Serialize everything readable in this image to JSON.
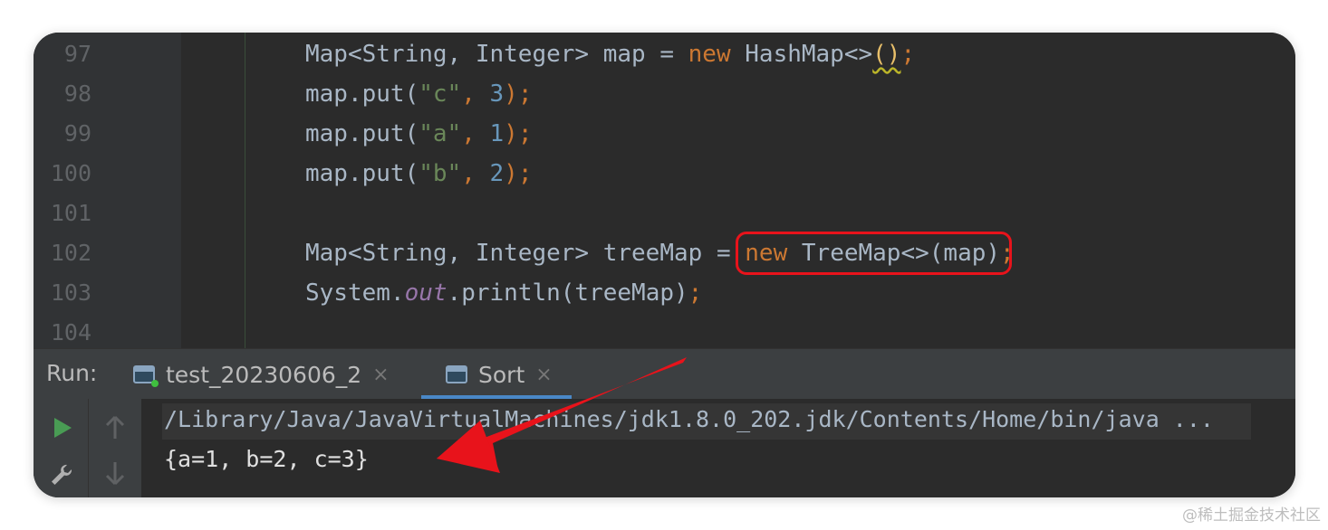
{
  "editor": {
    "line_numbers": [
      "97",
      "98",
      "99",
      "100",
      "101",
      "102",
      "103",
      "104"
    ],
    "lines": [
      [
        {
          "t": "Map<String, Integer> map = ",
          "c": "plain"
        },
        {
          "t": "new",
          "c": "kw"
        },
        {
          "t": " HashMap<>",
          "c": "plain"
        },
        {
          "t": "()",
          "c": "brace squig"
        },
        {
          "t": ";",
          "c": "kw"
        }
      ],
      [
        {
          "t": "map.put(",
          "c": "plain"
        },
        {
          "t": "\"c\"",
          "c": "str"
        },
        {
          "t": ", ",
          "c": "kw"
        },
        {
          "t": "3",
          "c": "num"
        },
        {
          "t": ");",
          "c": "kw"
        }
      ],
      [
        {
          "t": "map.put(",
          "c": "plain"
        },
        {
          "t": "\"a\"",
          "c": "str"
        },
        {
          "t": ", ",
          "c": "kw"
        },
        {
          "t": "1",
          "c": "num"
        },
        {
          "t": ");",
          "c": "kw"
        }
      ],
      [
        {
          "t": "map.put(",
          "c": "plain"
        },
        {
          "t": "\"b\"",
          "c": "str"
        },
        {
          "t": ", ",
          "c": "kw"
        },
        {
          "t": "2",
          "c": "num"
        },
        {
          "t": ");",
          "c": "kw"
        }
      ],
      [],
      [
        {
          "t": "Map<String, Integer> treeMap = ",
          "c": "plain"
        },
        {
          "t": "new",
          "c": "kw"
        },
        {
          "t": " TreeMap<>(map)",
          "c": "plain"
        },
        {
          "t": ";",
          "c": "kw"
        }
      ],
      [
        {
          "t": "System.",
          "c": "plain"
        },
        {
          "t": "out",
          "c": "fld"
        },
        {
          "t": ".println(treeMap)",
          "c": "plain"
        },
        {
          "t": ";",
          "c": "kw"
        }
      ],
      []
    ]
  },
  "run_panel": {
    "label": "Run:",
    "tabs": [
      {
        "label": "test_20230606_2",
        "close": "×"
      },
      {
        "label": "Sort",
        "close": "×"
      }
    ]
  },
  "console": {
    "command": "/Library/Java/JavaVirtualMachines/jdk1.8.0_202.jdk/Contents/Home/bin/java ...",
    "output": "{a=1, b=2, c=3}"
  },
  "icons": {
    "run": "play-icon",
    "settings": "wrench-icon",
    "scroll_up": "arrow-up-icon",
    "scroll_down": "arrow-down-icon"
  },
  "colors": {
    "annotation": "#e8131b",
    "play": "#499c54"
  },
  "watermark": "@稀土掘金技术社区"
}
